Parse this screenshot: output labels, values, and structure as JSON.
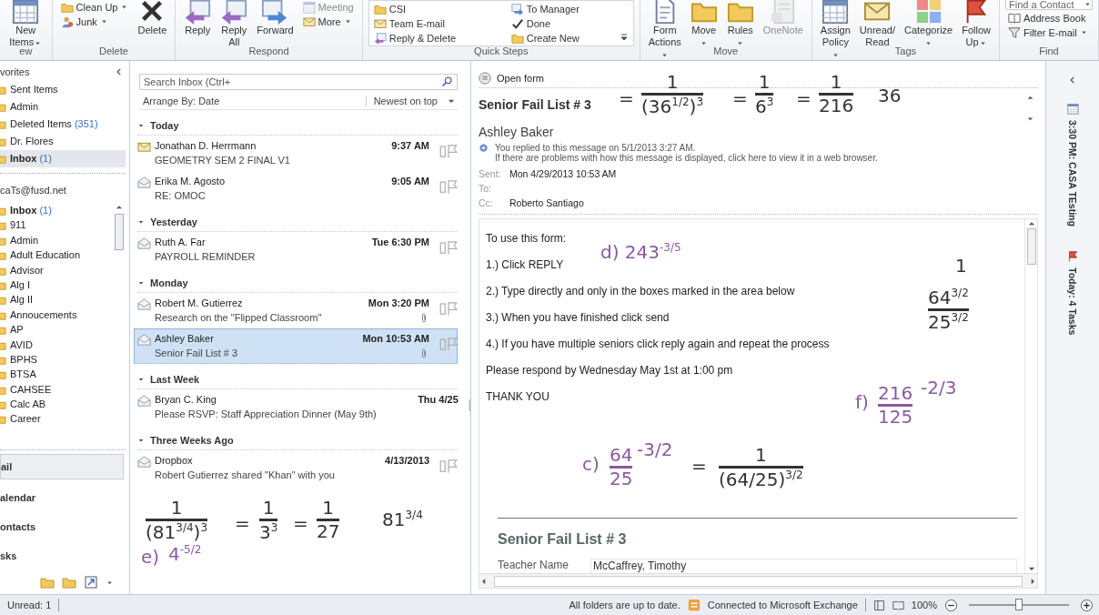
{
  "ribbon": {
    "groups": [
      {
        "label": "ew",
        "buttons": [
          {
            "kind": "large",
            "label": "New Items",
            "dropdown": true,
            "disabled": false
          }
        ]
      },
      {
        "label": "Delete",
        "buttons": [
          {
            "kind": "small",
            "label": "Clean Up",
            "dropdown": true,
            "disabled": false
          },
          {
            "kind": "small",
            "label": "Junk",
            "dropdown": true,
            "disabled": false
          },
          {
            "kind": "large",
            "label": "Delete",
            "dropdown": false,
            "disabled": false
          }
        ]
      },
      {
        "label": "Respond",
        "buttons": [
          {
            "kind": "large",
            "label": "Reply",
            "dropdown": false,
            "disabled": false
          },
          {
            "kind": "large",
            "label": "Reply All",
            "dropdown": false,
            "disabled": false
          },
          {
            "kind": "large",
            "label": "Forward",
            "dropdown": false,
            "disabled": false
          },
          {
            "kind": "small",
            "label": "Meeting",
            "dropdown": false,
            "disabled": true
          },
          {
            "kind": "small",
            "label": "More",
            "dropdown": true,
            "disabled": false
          }
        ]
      },
      {
        "label": "Quick Steps",
        "buttons": [
          {
            "kind": "quick",
            "label": "CSI"
          },
          {
            "kind": "quick",
            "label": "Team E-mail"
          },
          {
            "kind": "quick",
            "label": "Reply & Delete"
          },
          {
            "kind": "quick",
            "label": "To Manager"
          },
          {
            "kind": "quick",
            "label": "Done"
          },
          {
            "kind": "quick",
            "label": "Create New"
          }
        ]
      },
      {
        "label": "Move",
        "buttons": [
          {
            "kind": "large",
            "label": "Form Actions",
            "dropdown": true,
            "disabled": false
          },
          {
            "kind": "large",
            "label": "Move",
            "dropdown": true,
            "disabled": false
          },
          {
            "kind": "large",
            "label": "Rules",
            "dropdown": true,
            "disabled": false
          },
          {
            "kind": "large",
            "label": "OneNote",
            "dropdown": false,
            "disabled": true
          }
        ]
      },
      {
        "label": "Tags",
        "buttons": [
          {
            "kind": "large",
            "label": "Assign Policy",
            "dropdown": true,
            "disabled": false
          },
          {
            "kind": "large",
            "label": "Unread/ Read",
            "dropdown": false,
            "disabled": false
          },
          {
            "kind": "large",
            "label": "Categorize",
            "dropdown": true,
            "disabled": false
          },
          {
            "kind": "large",
            "label": "Follow Up",
            "dropdown": true,
            "disabled": false
          }
        ]
      },
      {
        "label": "Find",
        "buttons": [
          {
            "kind": "field",
            "label": "Find a Contact",
            "dropdown": true,
            "disabled": false
          },
          {
            "kind": "small",
            "label": "Address Book",
            "dropdown": false,
            "disabled": false
          },
          {
            "kind": "small",
            "label": "Filter E-mail",
            "dropdown": true,
            "disabled": false
          }
        ]
      }
    ]
  },
  "navigation": {
    "favorites": {
      "header": "vorites",
      "items": [
        {
          "label": "Sent Items",
          "selected": false
        },
        {
          "label": "Admin",
          "selected": false
        },
        {
          "label": "Deleted Items",
          "count": "(351)",
          "selected": false
        },
        {
          "label": "Dr. Flores",
          "selected": false
        },
        {
          "label": "Inbox",
          "count": "(1)",
          "selected": true
        }
      ]
    },
    "account": {
      "header": "caTs@fusd.net",
      "items": [
        {
          "label": "Inbox",
          "count": "(1)",
          "selected": false
        },
        {
          "label": "911",
          "selected": false
        },
        {
          "label": "Admin",
          "selected": false
        },
        {
          "label": "Adult Education",
          "selected": false
        },
        {
          "label": "Advisor",
          "selected": false
        },
        {
          "label": "Alg I",
          "selected": false
        },
        {
          "label": "Alg II",
          "selected": false
        },
        {
          "label": "Annoucements",
          "selected": false
        },
        {
          "label": "AP",
          "selected": false
        },
        {
          "label": "AVID",
          "selected": false
        },
        {
          "label": "BPHS",
          "selected": false
        },
        {
          "label": "BTSA",
          "selected": false
        },
        {
          "label": "CAHSEE",
          "selected": false
        },
        {
          "label": "Calc AB",
          "selected": false
        },
        {
          "label": "Career",
          "selected": false
        }
      ]
    },
    "modules": [
      {
        "label": "ail",
        "selected": true
      },
      {
        "label": "alendar",
        "selected": false
      },
      {
        "label": "ontacts",
        "selected": false
      },
      {
        "label": "sks",
        "selected": false
      }
    ]
  },
  "message_list": {
    "search": {
      "placeholder": "Search Inbox (Ctrl+"
    },
    "arrange_by": "Arrange By: Date",
    "sort_order": "Newest on top",
    "groups": [
      {
        "label": "Today",
        "messages": [
          {
            "sender": "Jonathan D. Herrmann",
            "subject": "GEOMETRY SEM 2 FINAL V1",
            "time": "9:37 AM",
            "attachment": false,
            "selected": false
          },
          {
            "sender": "Erika M. Agosto",
            "subject": "RE: OMOC",
            "time": "9:05 AM",
            "attachment": false,
            "selected": false
          }
        ]
      },
      {
        "label": "Yesterday",
        "messages": [
          {
            "sender": "Ruth A. Far",
            "subject": "PAYROLL REMINDER",
            "time": "Tue 6:30 PM",
            "attachment": false,
            "selected": false
          }
        ]
      },
      {
        "label": "Monday",
        "messages": [
          {
            "sender": "Robert M. Gutierrez",
            "subject": "Research on the \"Flipped Classroom\"",
            "time": "Mon 3:20 PM",
            "attachment": true,
            "selected": false
          },
          {
            "sender": "Ashley Baker",
            "subject": "Senior Fail List # 3",
            "time": "Mon 10:53 AM",
            "attachment": true,
            "selected": true
          }
        ]
      },
      {
        "label": "Last Week",
        "messages": [
          {
            "sender": "Bryan C. King",
            "subject": "Please RSVP: Staff Appreciation Dinner (May 9th)",
            "time": "Thu 4/25",
            "attachment": false,
            "selected": false
          }
        ]
      },
      {
        "label": "Three Weeks Ago",
        "messages": [
          {
            "sender": "Dropbox",
            "subject": "Robert Gutierrez shared \"Khan\" with you",
            "time": "4/13/2013",
            "attachment": false,
            "selected": false
          }
        ]
      }
    ]
  },
  "reading_pane": {
    "open_form": "Open form",
    "subject": "Senior Fail List # 3",
    "sender": "Ashley Baker",
    "info": [
      "You replied to this message on 5/1/2013 3:27 AM.",
      "If there are problems with how this message is displayed, click here to view it in a web browser."
    ],
    "fields": [
      {
        "label": "Sent:",
        "value": "Mon 4/29/2013 10:53 AM"
      },
      {
        "label": "To:"
      },
      {
        "label": "Cc:",
        "value": "Roberto Santiago"
      }
    ],
    "body": [
      "To use this form:",
      "1.) Click REPLY",
      "2.) Type directly and only in the boxes marked in the area below",
      "3.) When you have finished click send",
      "4.) If you have multiple seniors click reply again and repeat the process",
      "Please respond by Wednesday May 1st at 1:00 pm",
      "THANK YOU"
    ],
    "form": {
      "title": "Senior Fail List # 3",
      "field_label": "Teacher Name",
      "field_value": "McCaffrey, Timothy"
    }
  },
  "todo_bar": {
    "appointment": "3:30 PM: CASA TEsting",
    "tasks": "Today: 4 Tasks"
  },
  "status_bar": {
    "unread": "Unread: 1",
    "sync": "All folders are up to date.",
    "connection": "Connected to Microsoft Exchange",
    "zoom": "100%",
    "zoom_slider": {
      "level": 0.5
    }
  },
  "ink": [
    {
      "kind": "text",
      "text": "=",
      "color": "#333333"
    },
    {
      "kind": "fraction",
      "num": "1",
      "den": "(36$^{1/2}$)$^{3}$",
      "color": "#333333"
    },
    {
      "kind": "text",
      "text": "=",
      "color": "#333333"
    },
    {
      "kind": "fraction",
      "num": "1",
      "den": "6$^{3}$",
      "color": "#333333"
    },
    {
      "kind": "text",
      "text": "=",
      "color": "#333333"
    },
    {
      "kind": "fraction",
      "num": "1",
      "den": "216",
      "color": "#333333"
    },
    {
      "kind": "text",
      "text": "36",
      "color": "#333333"
    },
    {
      "kind": "text",
      "text": "d) 243$^{-3/5}$",
      "color": "#8a5a9e"
    },
    {
      "kind": "text",
      "text": "1",
      "color": "#333333"
    },
    {
      "kind": "fraction",
      "num": "64$^{3/2}$",
      "den": "25$^{3/2}$",
      "color": "#333333"
    },
    {
      "kind": "text",
      "text": "f)",
      "color": "#8a5a9e"
    },
    {
      "kind": "fraction",
      "num": "216",
      "den": "125",
      "color": "#8a5a9e"
    },
    {
      "kind": "text",
      "text": "-2/3",
      "color": "#8a5a9e"
    },
    {
      "kind": "text",
      "text": "c)",
      "color": "#8a5a9e"
    },
    {
      "kind": "fraction",
      "num": "64",
      "den": "25",
      "color": "#8a5a9e"
    },
    {
      "kind": "text",
      "text": "-3/2",
      "color": "#8a5a9e"
    },
    {
      "kind": "text",
      "text": "=",
      "color": "#333333"
    },
    {
      "kind": "fraction",
      "num": "1",
      "den": "(64/25)$^{3/2}$",
      "color": "#333333"
    },
    {
      "kind": "fraction",
      "num": "1",
      "den": "(81$^{3/4}$)$^{3}$",
      "color": "#333333"
    },
    {
      "kind": "text",
      "text": "=",
      "color": "#333333"
    },
    {
      "kind": "fraction",
      "num": "1",
      "den": "3$^{3}$",
      "color": "#333333"
    },
    {
      "kind": "text",
      "text": "=",
      "color": "#333333"
    },
    {
      "kind": "fraction",
      "num": "1",
      "den": "27",
      "color": "#333333"
    },
    {
      "kind": "text",
      "text": "81$^{3/4}$",
      "color": "#333333"
    },
    {
      "kind": "text",
      "text": "e)",
      "color": "#8a5a9e"
    },
    {
      "kind": "text",
      "text": "4$^{-5/2}$",
      "color": "#8a5a9e"
    }
  ]
}
